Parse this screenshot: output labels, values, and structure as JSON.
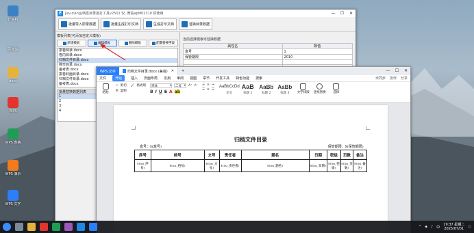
{
  "desktop": {
    "icons": [
      {
        "label": "计算机",
        "color": "#3b82c4"
      },
      {
        "label": "回收站",
        "color": "#9bb4c8"
      },
      {
        "label": "docs",
        "color": "#e6b23a"
      },
      {
        "label": "WPS",
        "color": "#e3342f"
      },
      {
        "label": "WPS 表格",
        "color": "#1f9d55"
      },
      {
        "label": "WPS 演示",
        "color": "#f27b1f"
      },
      {
        "label": "WPS 文字",
        "color": "#2d7ff9"
      }
    ]
  },
  "tool_window": {
    "title": "[ev-zlang]档案目录批打工具v2501 仅, 微信apM02310 供使用",
    "toolbar": {
      "import_label": "批量导入原录数据",
      "batch_label": "批量生成打印文档",
      "gen_label": "生成打印文档",
      "update_label": "替换目录数据"
    },
    "template_section_label": "模板列表(可添加自定义模板)",
    "template_buttons": {
      "add": "新增模板",
      "edit": "编辑模板",
      "delete": "删除模板",
      "config": "配置替换字段"
    },
    "templates": [
      "案卷目录.docx",
      "卷内目录.docx",
      "归档文件目录.docx",
      "移交目录.docx",
      "备考表.docx",
      "案卷封面目录.docx",
      "归档文件目录.docx",
      "备考表.docx"
    ],
    "selected_template_index": 2,
    "replace_list_header": "批量替换数据列表",
    "replace_rows": [
      "1",
      "2",
      "3",
      "4"
    ],
    "right_section_label": "当前选择模板可替换数据",
    "table_headers": [
      "属性名",
      "数值"
    ],
    "table_rows": [
      [
        "盒号",
        "1"
      ],
      [
        "保管期限",
        "2010"
      ]
    ]
  },
  "wps": {
    "brand_tab": "WPS 文字",
    "doc_tab": "归档文件目录.docx (兼容)",
    "menu": [
      "文件",
      "开始",
      "插入",
      "页面布局",
      "引用",
      "审阅",
      "视图",
      "章节",
      "开发工具",
      "特色功能",
      "搜索"
    ],
    "menu_right": [
      "未同步",
      "协作",
      "分享"
    ],
    "ribbon": {
      "paste": "粘贴",
      "cut": "剪切",
      "copy": "复制",
      "format_painter": "格式刷",
      "font_name": "宋体",
      "font_size": "二号",
      "styles": [
        {
          "sample": "AaBbCcDd",
          "label": "正文",
          "small": true
        },
        {
          "sample": "AaB",
          "label": "标题 1",
          "small": false
        },
        {
          "sample": "AaBb",
          "label": "标题 2",
          "small": false
        },
        {
          "sample": "AaBb",
          "label": "标题 3",
          "small": false
        }
      ],
      "text_tools": "文字排版",
      "find_replace": "查找替换",
      "select": "选择"
    },
    "document": {
      "title": "归档文件目录",
      "box_no": "盒号：${盒号}",
      "retention": "保管期限：${保管期限}",
      "headers": [
        "序号",
        "档号",
        "文号",
        "责任者",
        "题名",
        "日期",
        "密级",
        "页数",
        "备注"
      ],
      "row": [
        "${list_序号}",
        "${list_档号}",
        "${list_文号}",
        "${list_责任者}",
        "${list_题名}",
        "${list_日期}",
        "${list_密级}",
        "${list_页数}",
        "${list_备注}"
      ]
    }
  },
  "taskbar": {
    "time": "19:37 星期二",
    "date": "2025/07/01",
    "lang": "中"
  }
}
